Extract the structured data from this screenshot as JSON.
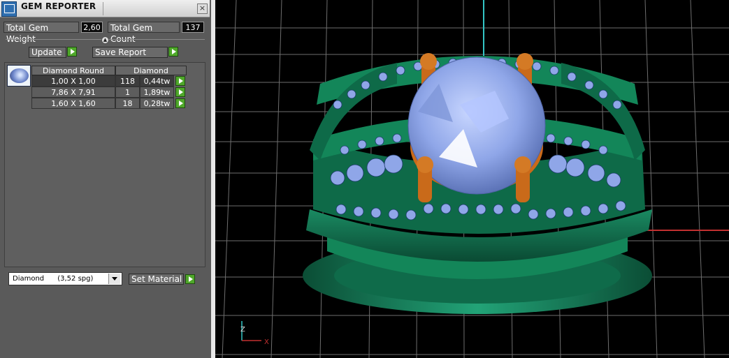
{
  "window": {
    "title": "GEM REPORTER",
    "close_glyph": "×",
    "icon": "gem-reporter-app-icon"
  },
  "stats": {
    "weight_label": "Total Gem Weight",
    "weight_value": "2,60",
    "count_label": "Total Gem Count",
    "count_value": "137"
  },
  "actions": {
    "update_label": "Update",
    "save_label": "Save Report",
    "collapse_glyph": "▲"
  },
  "table": {
    "headers": [
      "Diamond Round",
      "Diamond"
    ],
    "rows": [
      {
        "size": "1,00 X 1,00",
        "count": "118",
        "weight": "0,44tw"
      },
      {
        "size": "7,86 X 7,91",
        "count": "1",
        "weight": "1,89tw"
      },
      {
        "size": "1,60 X 1,60",
        "count": "18",
        "weight": "0,28tw"
      }
    ]
  },
  "material": {
    "selected": "Diamond      (3,52 spg)",
    "set_label": "Set Material"
  },
  "axes": {
    "z": "Z",
    "x": "X"
  },
  "colors": {
    "panel_bg": "#5a5a5a",
    "play_green": "#4fa82a",
    "viewport_bg": "#000000",
    "grid": "#6e6e6e",
    "ring_green": "#0f6b4a",
    "prong_orange": "#c96a1a",
    "gem_blue": "#8fa6e8"
  }
}
